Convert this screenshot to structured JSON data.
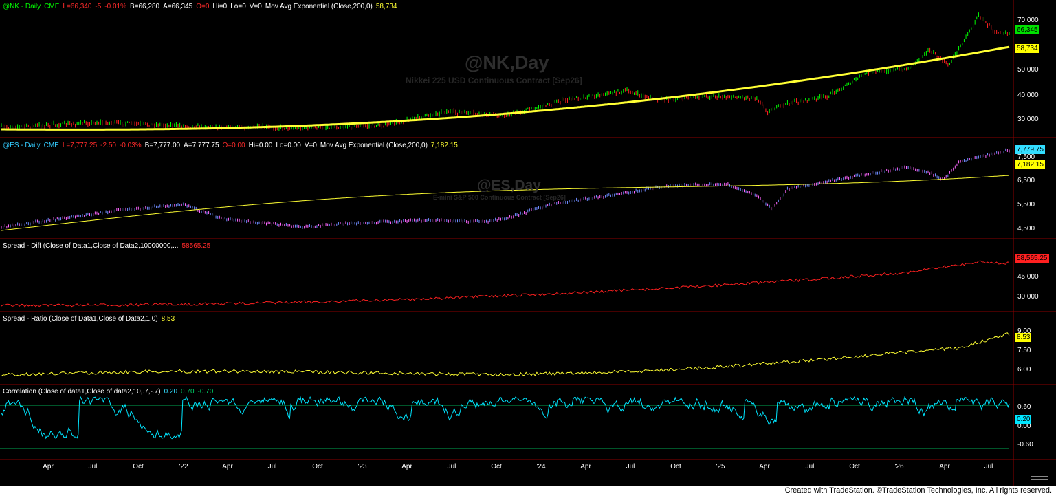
{
  "panels": {
    "nk": {
      "header": [
        {
          "text": "@NK - Daily",
          "color": "#00ff00"
        },
        {
          "text": "CME",
          "color": "#00ff00"
        },
        {
          "text": "L=66,340",
          "color": "#ff2a2a"
        },
        {
          "text": "-5",
          "color": "#ff2a2a"
        },
        {
          "text": "-0.01%",
          "color": "#ff2a2a"
        },
        {
          "text": "B=66,280",
          "color": "#ffffff"
        },
        {
          "text": "A=66,345",
          "color": "#ffffff"
        },
        {
          "text": "O=0",
          "color": "#ff2a2a"
        },
        {
          "text": "Hi=0",
          "color": "#ffffff"
        },
        {
          "text": "Lo=0",
          "color": "#ffffff"
        },
        {
          "text": "V=0",
          "color": "#ffffff"
        },
        {
          "text": "Mov Avg Exponential (Close,200,0)",
          "color": "#ffffff"
        },
        {
          "text": "58,734",
          "color": "#ffff33"
        }
      ],
      "watermark_title": "@NK,Day",
      "watermark_subtitle": "Nikkei 225 USD Continuous Contract [Sep26]",
      "axis_labels": [
        "70,000",
        "50,000",
        "40,000",
        "30,000"
      ],
      "price_tags": [
        {
          "text": "66,345",
          "color": "#00e000"
        },
        {
          "text": "58,734",
          "color": "#ffff00"
        }
      ]
    },
    "es": {
      "header": [
        {
          "text": "@ES - Daily",
          "color": "#33ccff"
        },
        {
          "text": "CME",
          "color": "#33ccff"
        },
        {
          "text": "L=7,777.25",
          "color": "#ff2a2a"
        },
        {
          "text": "-2.50",
          "color": "#ff2a2a"
        },
        {
          "text": "-0.03%",
          "color": "#ff2a2a"
        },
        {
          "text": "B=7,777.00",
          "color": "#ffffff"
        },
        {
          "text": "A=7,777.75",
          "color": "#ffffff"
        },
        {
          "text": "O=0.00",
          "color": "#ff2a2a"
        },
        {
          "text": "Hi=0.00",
          "color": "#ffffff"
        },
        {
          "text": "Lo=0.00",
          "color": "#ffffff"
        },
        {
          "text": "V=0",
          "color": "#ffffff"
        },
        {
          "text": "Mov Avg Exponential (Close,200,0)",
          "color": "#ffffff"
        },
        {
          "text": "7,182.15",
          "color": "#ffff33"
        }
      ],
      "watermark_title": "@ES,Day",
      "watermark_subtitle": "E-mini S&P 500 Continuous Contract [Sep26]",
      "axis_labels": [
        "7,500",
        "6,500",
        "5,500",
        "4,500"
      ],
      "price_tags": [
        {
          "text": "7,779.75",
          "color": "#33ddff"
        },
        {
          "text": "7,182.15",
          "color": "#ffff00"
        }
      ]
    },
    "diff": {
      "header": [
        {
          "text": "Spread - Diff (Close of Data1,Close of Data2,10000000,...",
          "color": "#ffffff"
        },
        {
          "text": "58565.25",
          "color": "#ff2a2a"
        }
      ],
      "axis_labels": [
        "45,000",
        "30,000"
      ],
      "price_tags": [
        {
          "text": "58,565.25",
          "color": "#ff2020"
        }
      ]
    },
    "ratio": {
      "header": [
        {
          "text": "Spread - Ratio (Close of Data1,Close of Data2,1,0)",
          "color": "#ffffff"
        },
        {
          "text": "8.53",
          "color": "#ffff33"
        }
      ],
      "axis_labels": [
        "9.00",
        "7.50",
        "6.00"
      ],
      "price_tags": [
        {
          "text": "8.53",
          "color": "#ffff00"
        }
      ]
    },
    "corr": {
      "header": [
        {
          "text": "Correlation (Close of data1,Close of data2,10,.7,-.7)",
          "color": "#ffffff"
        },
        {
          "text": "0.20",
          "color": "#33ddff"
        },
        {
          "text": "0.70",
          "color": "#00cc66"
        },
        {
          "text": "-0.70",
          "color": "#00cc66"
        }
      ],
      "axis_labels": [
        "0.60",
        "0.00",
        "-0.60"
      ],
      "price_tags": [
        {
          "text": "0.20",
          "color": "#00e5ff"
        }
      ]
    }
  },
  "date_axis": [
    "Apr",
    "Jul",
    "Oct",
    "'22",
    "Apr",
    "Jul",
    "Oct",
    "'23",
    "Apr",
    "Jul",
    "Oct",
    "'24",
    "Apr",
    "Jul",
    "Oct",
    "'25",
    "Apr",
    "Jul",
    "Oct",
    "'26",
    "Apr",
    "Jul"
  ],
  "footer": "Created with TradeStation. ©TradeStation Technologies, Inc. All rights reserved.",
  "colors": {
    "background": "#000000",
    "separator": "#8b0000",
    "up_bar": "#00ff00",
    "down_bar": "#ff2020",
    "moving_average": "#ffff33",
    "es_bars": "#6f8cff",
    "diff_line": "#ff2020",
    "ratio_line": "#ffff33",
    "corr_line": "#00e5ff",
    "corr_threshold": "#00aa55"
  }
}
